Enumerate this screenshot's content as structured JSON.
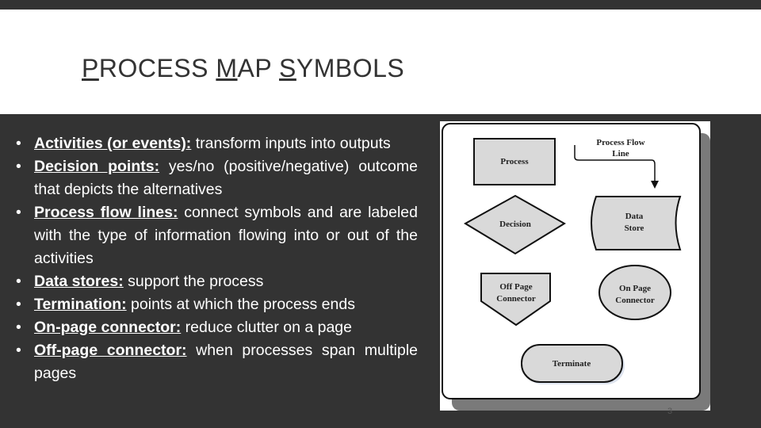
{
  "slide": {
    "title_parts": [
      {
        "text": "P",
        "underline": true
      },
      {
        "text": "ROCESS ",
        "underline": false
      },
      {
        "text": "M",
        "underline": true
      },
      {
        "text": "AP ",
        "underline": false
      },
      {
        "text": "S",
        "underline": true
      },
      {
        "text": "YMBOLS",
        "underline": false
      }
    ],
    "bullets": [
      {
        "label": "Activities (or events):",
        "text": " transform inputs into outputs"
      },
      {
        "label": "Decision points:",
        "text": " yes/no (positive/negative) outcome that depicts the alternatives"
      },
      {
        "label": "Process flow lines:",
        "text": " connect symbols and are labeled with the type of information flowing into or out of the activities"
      },
      {
        "label": "Data stores:",
        "text": " support the process"
      },
      {
        "label": "Termination:",
        "text": " points at which the process ends"
      },
      {
        "label": "On-page connector:",
        "text": " reduce clutter on a page"
      },
      {
        "label": "Off-page connector:",
        "text": " when processes span multiple pages"
      }
    ],
    "page_number": "3"
  },
  "diagram": {
    "process": "Process",
    "flow_line": [
      "Process Flow",
      "Line"
    ],
    "decision": "Decision",
    "data_store": [
      "Data",
      "Store"
    ],
    "off_page": [
      "Off Page",
      "Connector"
    ],
    "on_page": [
      "On Page",
      "Connector"
    ],
    "terminate": "Terminate",
    "colors": {
      "shape_fill": "#d9d9d9",
      "stroke": "#111111",
      "shadow": "#7a7a7a"
    }
  }
}
